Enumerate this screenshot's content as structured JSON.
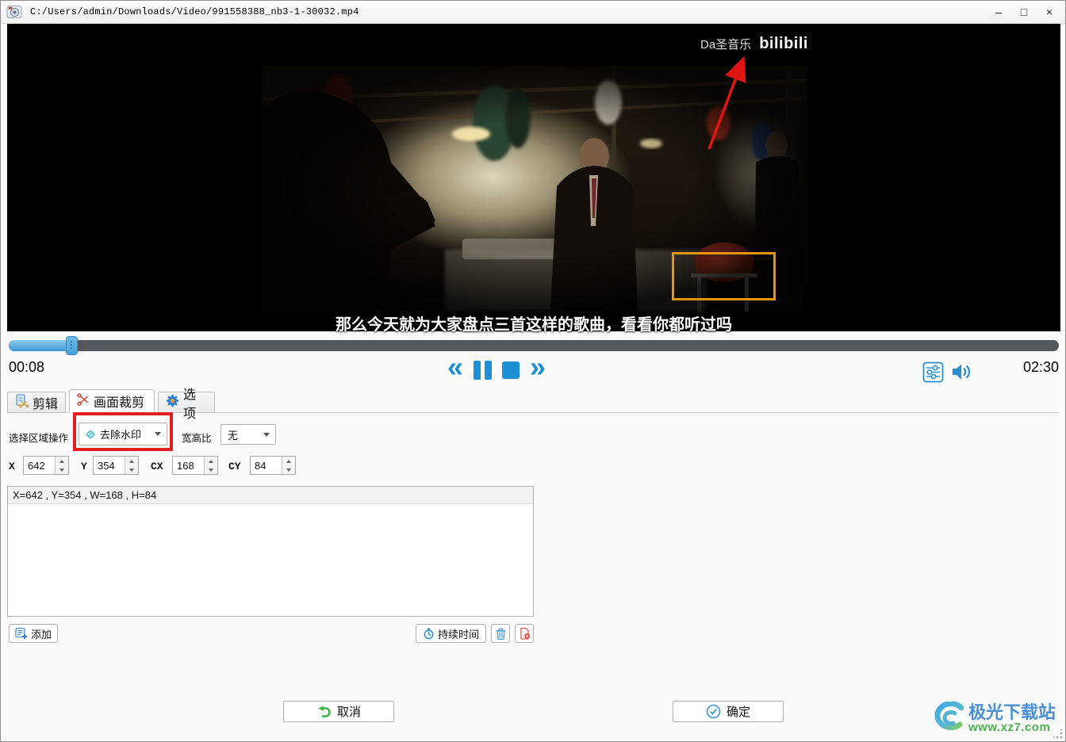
{
  "window": {
    "title": "C:/Users/admin/Downloads/Video/991558388_nb3-1-30032.mp4",
    "minimize_glyph": "–",
    "maximize_glyph": "□",
    "close_glyph": "×"
  },
  "video": {
    "watermark_text": "Da圣音乐",
    "watermark_logo": "bilibili",
    "subtitle": "那么今天就为大家盘点三首这样的歌曲，看看你都听过吗"
  },
  "player": {
    "current_time": "00:08",
    "total_time": "02:30",
    "progress_percent": 6,
    "rewind_glyph": "«",
    "forward_glyph": "»"
  },
  "tabs": [
    {
      "label": "剪辑"
    },
    {
      "label": "画面裁剪"
    },
    {
      "label": "选项"
    }
  ],
  "panel": {
    "region_op_label": "选择区域操作",
    "region_op_value": "去除水印",
    "aspect_label": "宽高比",
    "aspect_value": "无",
    "coords": [
      {
        "label": "X",
        "value": "642"
      },
      {
        "label": "Y",
        "value": "354"
      },
      {
        "label": "CX",
        "value": "168"
      },
      {
        "label": "CY",
        "value": "84"
      }
    ],
    "region_item": "X=642 , Y=354 , W=168 , H=84",
    "add_label": "添加",
    "duration_label": "持续时间"
  },
  "footer": {
    "cancel_label": "取消",
    "ok_label": "确定"
  },
  "branding": {
    "site_name": "极光下载站",
    "site_url": "www.xz7.com"
  },
  "colors": {
    "accent_blue": "#1E8FD5",
    "highlight_red": "#E02020",
    "selection_orange": "#E8940A"
  }
}
